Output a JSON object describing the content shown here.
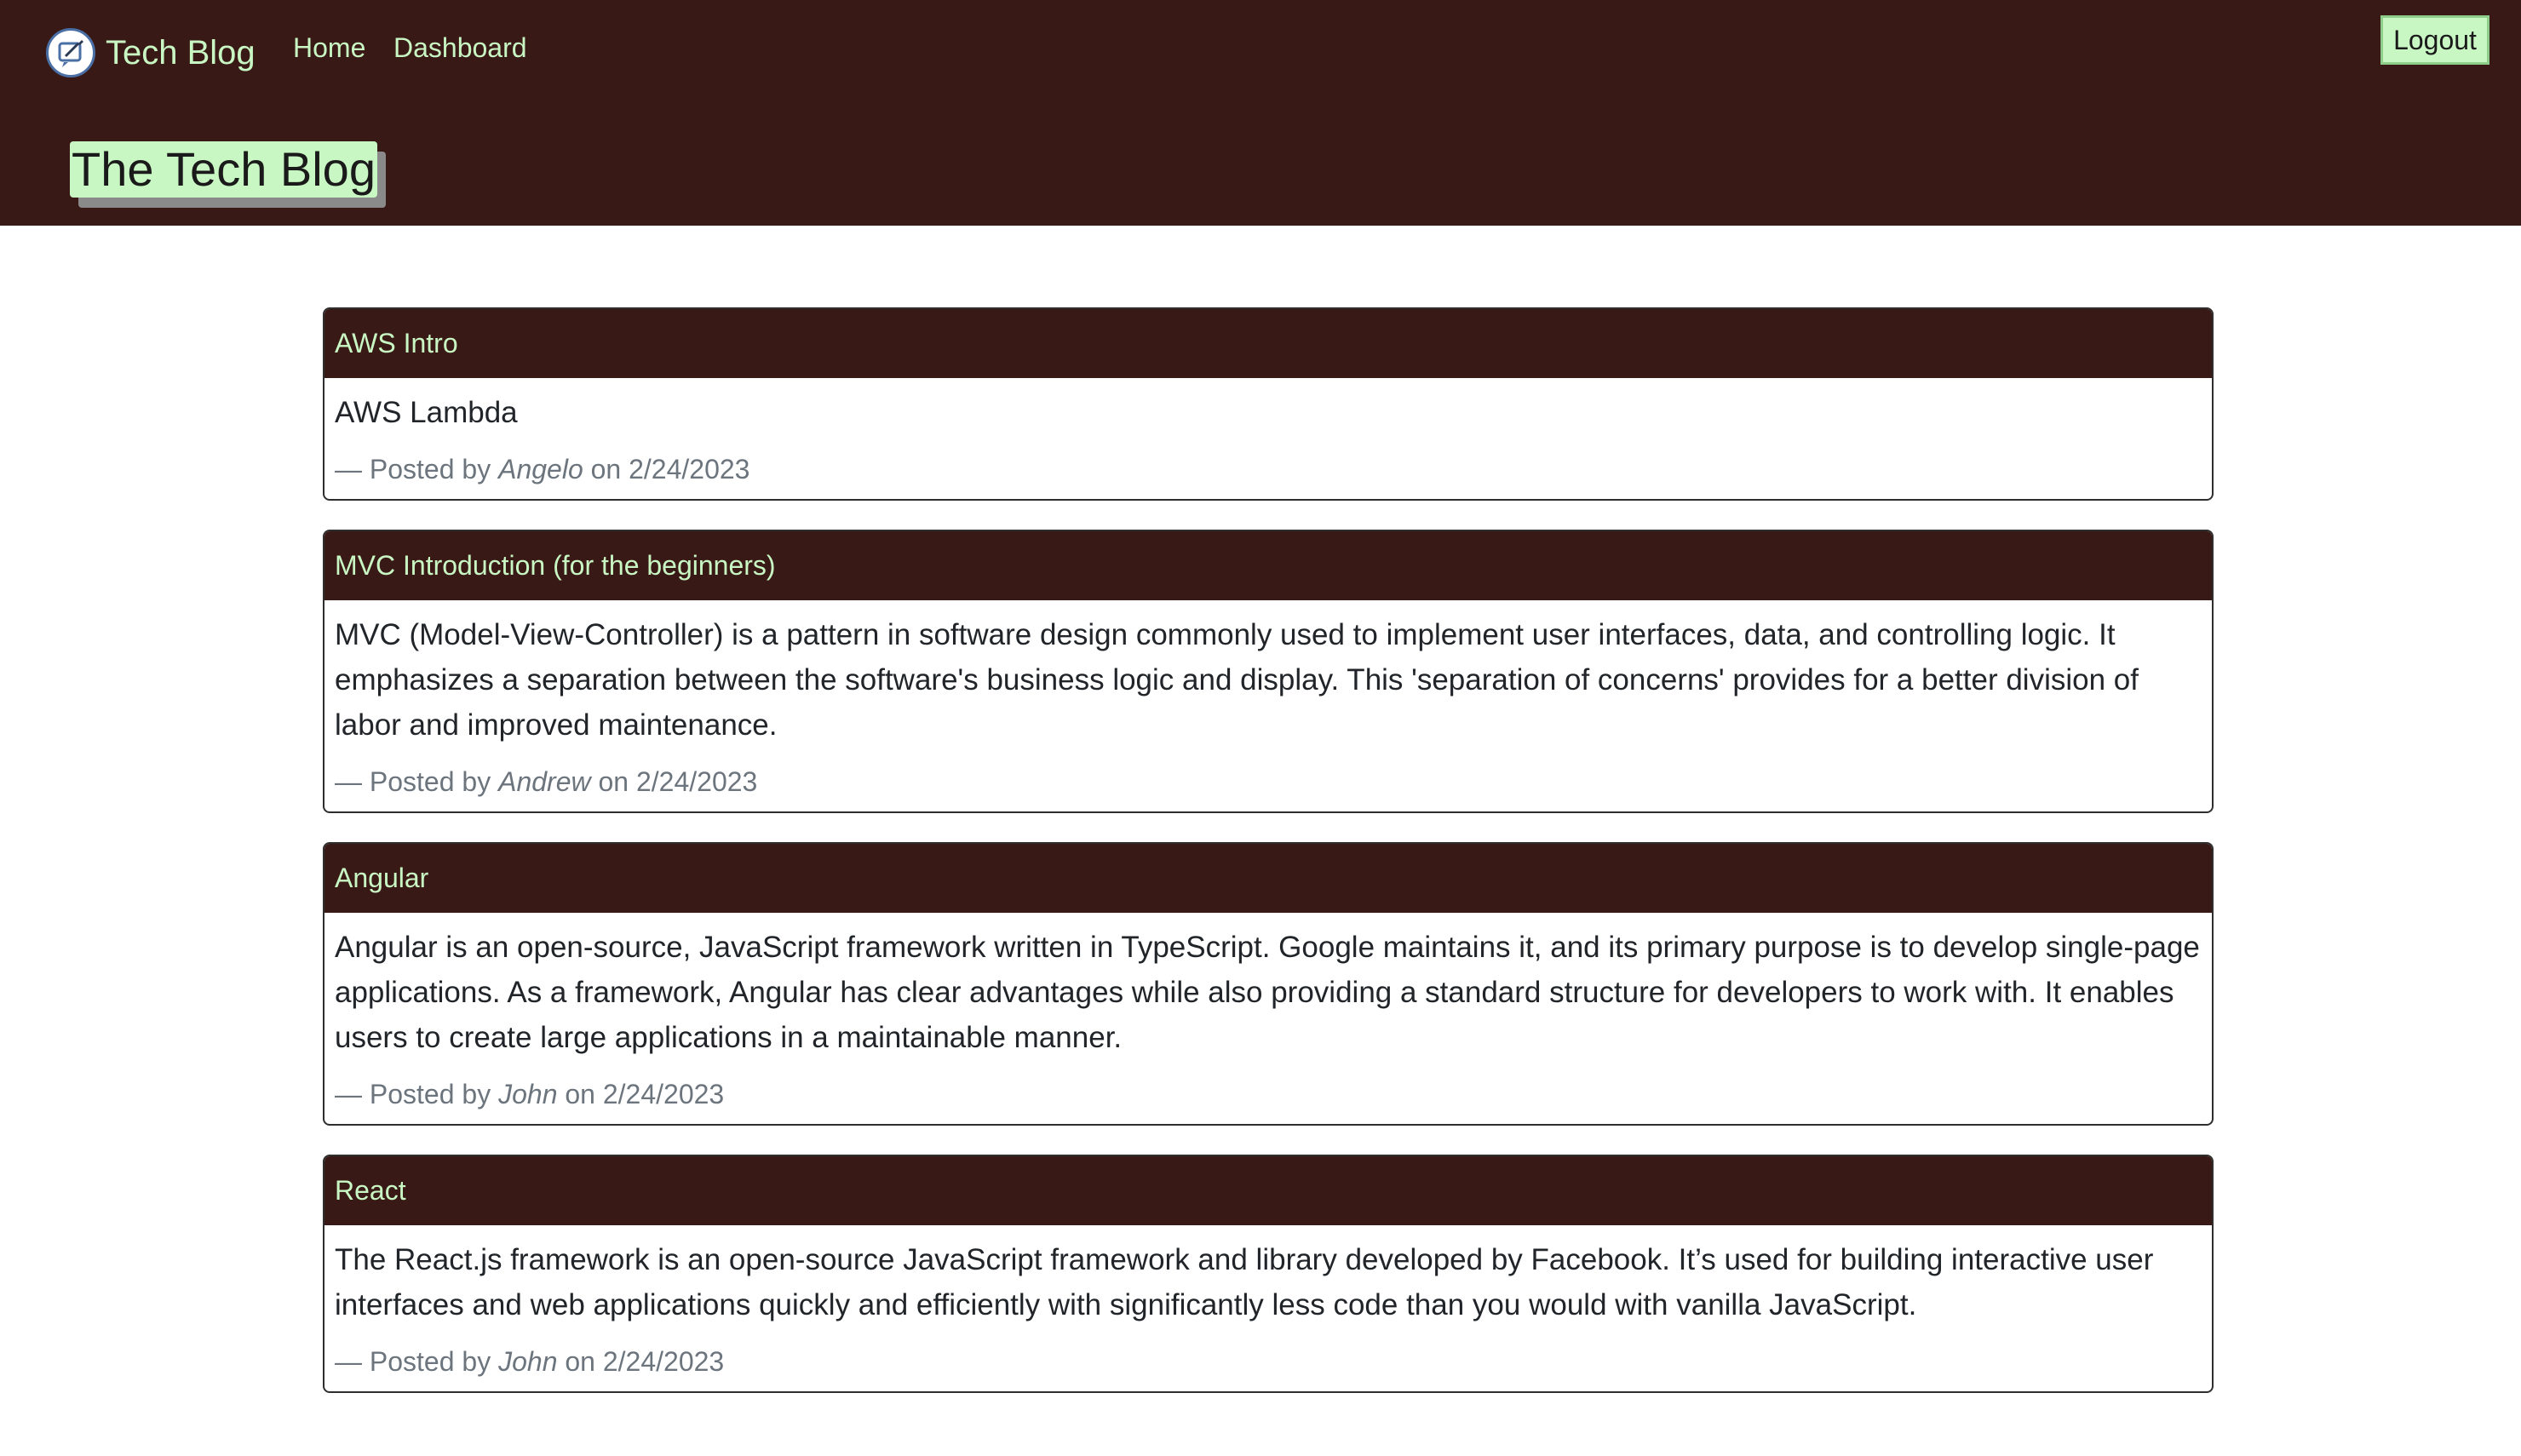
{
  "nav": {
    "brand": "Tech Blog",
    "links": [
      "Home",
      "Dashboard"
    ],
    "logout_label": "Logout",
    "logo_icon": "blog-logo-icon"
  },
  "hero": {
    "title": "The Tech Blog"
  },
  "byline": {
    "prefix": "— Posted by",
    "on": "on"
  },
  "posts": [
    {
      "title": "AWS Intro",
      "content": "AWS Lambda",
      "author": "Angelo",
      "date": "2/24/2023"
    },
    {
      "title": "MVC Introduction (for the beginners)",
      "content": "MVC (Model-View-Controller) is a pattern in software design commonly used to implement user interfaces, data, and controlling logic. It emphasizes a separation between the software's business logic and display. This 'separation of concerns' provides for a better division of labor and improved maintenance.",
      "author": "Andrew",
      "date": "2/24/2023"
    },
    {
      "title": "Angular",
      "content": "Angular is an open-source, JavaScript framework written in TypeScript. Google maintains it, and its primary purpose is to develop single-page applications. As a framework, Angular has clear advantages while also providing a standard structure for developers to work with. It enables users to create large applications in a maintainable manner.",
      "author": "John",
      "date": "2/24/2023"
    },
    {
      "title": "React",
      "content": "The React.js framework is an open-source JavaScript framework and library developed by Facebook. It’s used for building interactive user interfaces and web applications quickly and efficiently with significantly less code than you would with vanilla JavaScript.",
      "author": "John",
      "date": "2/24/2023"
    }
  ],
  "colors": {
    "header_bg": "#391915",
    "accent": "#c9f7c4"
  }
}
